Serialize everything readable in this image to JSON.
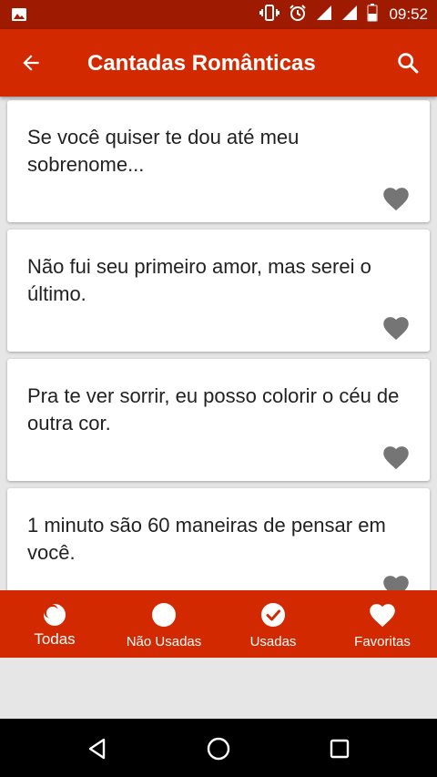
{
  "status_bar": {
    "time": "09:52",
    "icons": [
      "image-icon",
      "vibrate-icon",
      "alarm-icon",
      "signal-icon",
      "signal-icon",
      "battery-icon"
    ]
  },
  "app_bar": {
    "title": "Cantadas Românticas",
    "back_icon": "arrow-left-icon",
    "search_icon": "search-icon"
  },
  "cards": [
    {
      "text": "Se você quiser te dou até meu sobrenome...",
      "favorited": false
    },
    {
      "text": "Não fui seu primeiro amor, mas serei o último.",
      "favorited": false
    },
    {
      "text": "Pra te ver sorrir, eu posso colorir o céu de outra cor.",
      "favorited": false
    },
    {
      "text": "1 minuto são 60 maneiras de pensar em você.",
      "favorited": false
    }
  ],
  "bottom_nav": {
    "items": [
      {
        "label": "Todas",
        "icon": "moon-circle-icon",
        "active": true
      },
      {
        "label": "Não Usadas",
        "icon": "circle-icon",
        "active": false
      },
      {
        "label": "Usadas",
        "icon": "check-circle-icon",
        "active": false
      },
      {
        "label": "Favoritas",
        "icon": "heart-icon",
        "active": false
      }
    ]
  },
  "system_nav": {
    "icons": [
      "back-triangle-icon",
      "home-circle-icon",
      "recents-square-icon"
    ]
  },
  "colors": {
    "status_bar": "#9e1a00",
    "primary": "#d32900",
    "background": "#e6e6e6",
    "heart": "#757575",
    "text": "#222222"
  }
}
